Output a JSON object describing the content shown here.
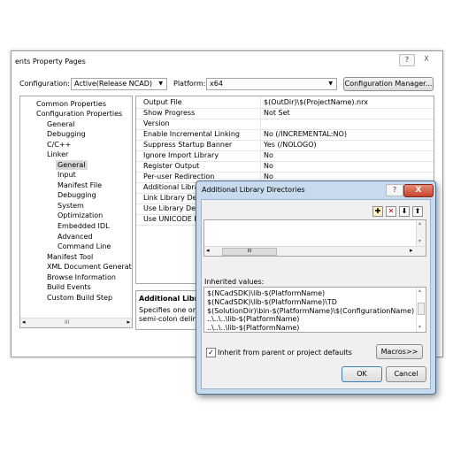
{
  "main_window": {
    "title": "ents Property Pages",
    "help_btn": "?",
    "close_btn": "X",
    "configuration_label": "Configuration:",
    "configuration_value": "Active(Release NCAD)",
    "platform_label": "Platform:",
    "platform_value": "x64",
    "config_manager_label": "Configuration Manager..."
  },
  "tree": {
    "items": [
      "Common Properties",
      "Configuration Properties",
      "General",
      "Debugging",
      "C/C++",
      "Linker",
      "General",
      "Input",
      "Manifest File",
      "Debugging",
      "System",
      "Optimization",
      "Embedded IDL",
      "Advanced",
      "Command Line",
      "Manifest Tool",
      "XML Document Generator",
      "Browse Information",
      "Build Events",
      "Custom Build Step"
    ],
    "scroll_thumb": "III"
  },
  "grid": {
    "rows": [
      {
        "name": "Output File",
        "value": "$(OutDir)\\$(ProjectName).nrx"
      },
      {
        "name": "Show Progress",
        "value": "Not Set"
      },
      {
        "name": "Version",
        "value": ""
      },
      {
        "name": "Enable Incremental Linking",
        "value": "No (/INCREMENTAL:NO)"
      },
      {
        "name": "Suppress Startup Banner",
        "value": "Yes (/NOLOGO)"
      },
      {
        "name": "Ignore Import Library",
        "value": "No"
      },
      {
        "name": "Register Output",
        "value": "No"
      },
      {
        "name": "Per-user Redirection",
        "value": "No"
      },
      {
        "name": "Additional Library",
        "value": ""
      },
      {
        "name": "Link Library Depe",
        "value": ""
      },
      {
        "name": "Use Library Deper",
        "value": ""
      },
      {
        "name": "Use UNICODE Re",
        "value": ""
      }
    ]
  },
  "description": {
    "title": "Additional Library",
    "line1": "Specifies one or mo",
    "line2": "semi-colon delimite"
  },
  "dialog": {
    "title": "Additional Library Directories",
    "help_btn": "?",
    "close_btn": "X",
    "hscroll_thumb": "III",
    "inherited_label": "Inherited values:",
    "inherited_values": [
      "$(NCadSDK)\\lib-$(PlatformName)",
      "$(NCadSDK)\\lib-$(PlatformName)\\TD",
      "$(SolutionDir)\\bin-$(PlatformName)\\$(ConfigurationName)",
      "..\\..\\..\\lib-$(PlatformName)",
      "..\\..\\..\\lib-$(PlatformName)"
    ],
    "inherit_label": "Inherit from parent or project defaults",
    "inherit_checked": true,
    "macros_label": "Macros>>",
    "ok_label": "OK",
    "cancel_label": "Cancel"
  }
}
